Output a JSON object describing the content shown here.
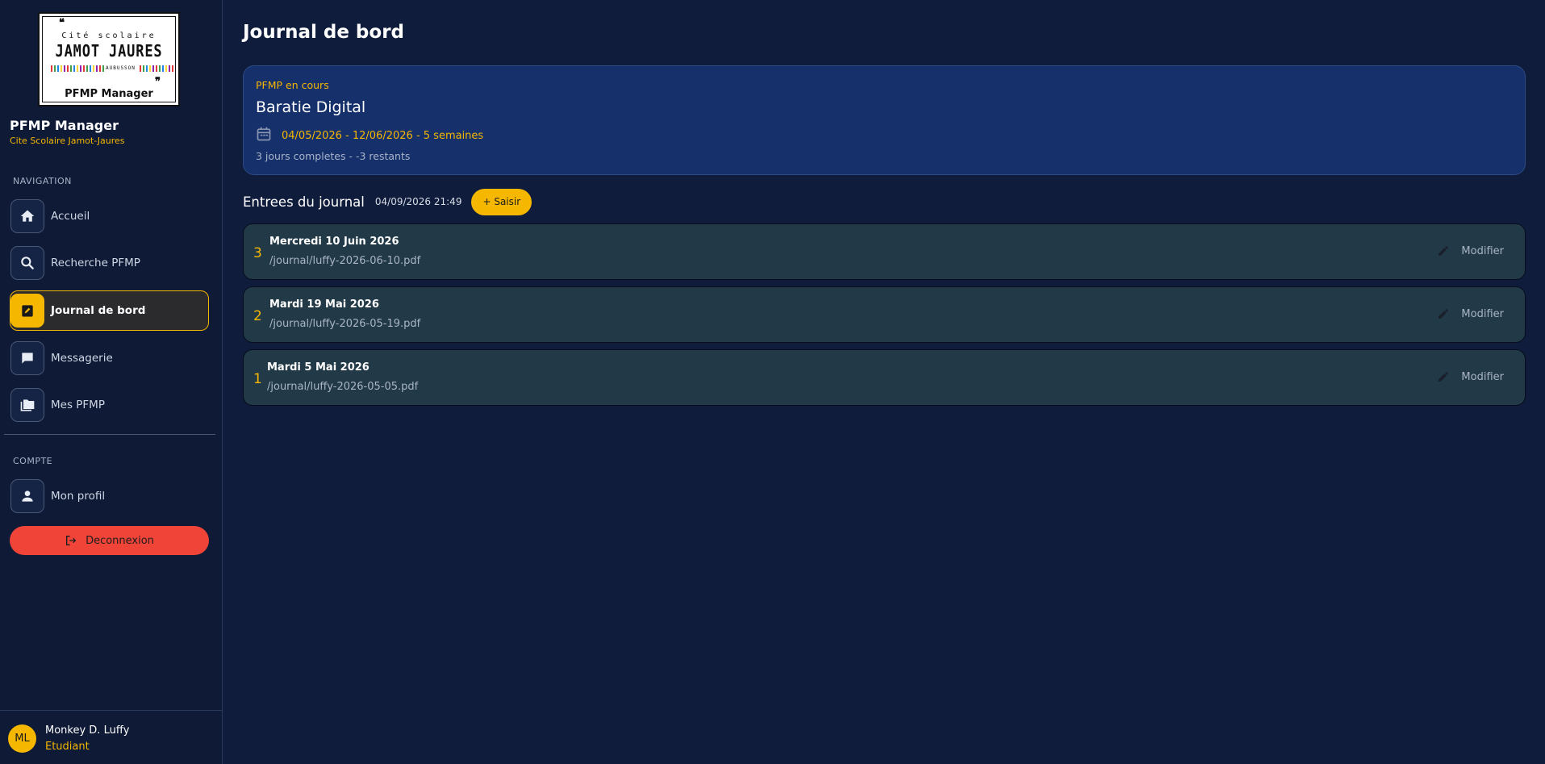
{
  "brand": {
    "logo_top": "Cité scolaire",
    "logo_main": "JAMOT JAURES",
    "logo_sub": "AUBUSSON",
    "logo_brand": "PFMP Manager",
    "app_title": "PFMP Manager",
    "app_subtitle": "Cite Scolaire Jamot-Jaures"
  },
  "nav": {
    "section_label": "NAVIGATION",
    "items": [
      {
        "label": "Accueil",
        "icon": "home-icon"
      },
      {
        "label": "Recherche PFMP",
        "icon": "search-icon"
      },
      {
        "label": "Journal de bord",
        "icon": "edit-note-icon",
        "active": true
      },
      {
        "label": "Messagerie",
        "icon": "chat-icon"
      },
      {
        "label": "Mes PFMP",
        "icon": "folders-icon"
      }
    ]
  },
  "account": {
    "section_label": "COMPTE",
    "profile_label": "Mon profil",
    "logout_label": "Deconnexion"
  },
  "user": {
    "initials": "ML",
    "name": "Monkey D. Luffy",
    "role": "Etudiant"
  },
  "page": {
    "title": "Journal de bord"
  },
  "pfmp": {
    "status": "PFMP en cours",
    "company": "Baratie Digital",
    "dates": "04/05/2026 - 12/06/2026 - 5 semaines",
    "progress": "3 jours completes - -3 restants"
  },
  "entries": {
    "title": "Entrees du journal",
    "timestamp": "04/09/2026 21:49",
    "add_label": "+ Saisir",
    "modify_label": "Modifier",
    "items": [
      {
        "num": "3",
        "date": "Mercredi 10 Juin 2026",
        "file": "/journal/luffy-2026-06-10.pdf"
      },
      {
        "num": "2",
        "date": "Mardi 19 Mai 2026",
        "file": "/journal/luffy-2026-05-19.pdf"
      },
      {
        "num": "1",
        "date": "Mardi 5 Mai 2026",
        "file": "/journal/luffy-2026-05-05.pdf"
      }
    ]
  },
  "colors": {
    "accent": "#f5b700",
    "danger": "#f04438",
    "background": "#0f1c3b"
  }
}
